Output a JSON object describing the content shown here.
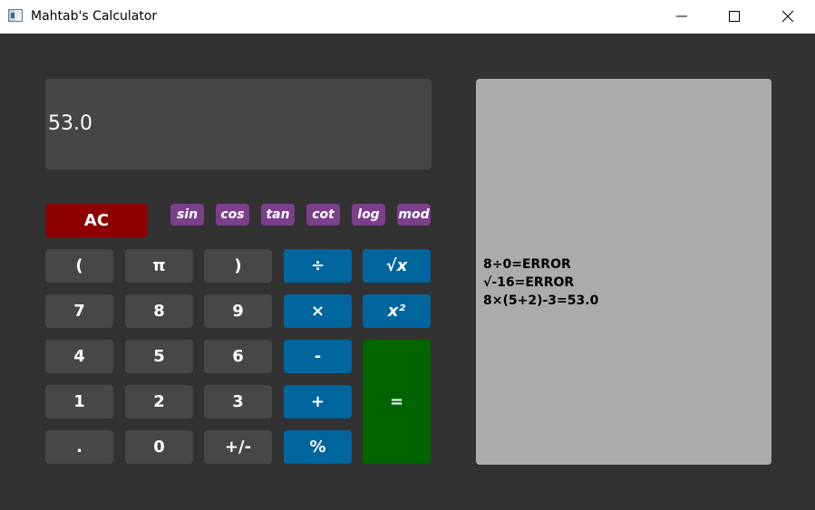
{
  "window": {
    "title": "Mahtab's Calculator",
    "controls": [
      "minimize",
      "maximize",
      "close"
    ]
  },
  "display": {
    "value": "53.0"
  },
  "history": {
    "entries": [
      "8÷0=ERROR",
      "√-16=ERROR",
      "8×(5+2)-3=53.0"
    ]
  },
  "buttons": {
    "ac": "AC",
    "functions": {
      "sin": "sin",
      "cos": "cos",
      "tan": "tan",
      "cot": "cot",
      "log": "log",
      "mod": "mod"
    },
    "lparen": "(",
    "pi": "π",
    "rparen": ")",
    "divide": "÷",
    "sqrt": "√x",
    "seven": "7",
    "eight": "8",
    "nine": "9",
    "multiply": "×",
    "square": "x²",
    "four": "4",
    "five": "5",
    "six": "6",
    "subtract": "-",
    "one": "1",
    "two": "2",
    "three": "3",
    "add": "+",
    "decimal": ".",
    "zero": "0",
    "negate": "+/-",
    "percent": "%",
    "equals": "="
  },
  "colors": {
    "background": "#323232",
    "number_key": "#474747",
    "operator_key": "#01659e",
    "function_key": "#7b3f8b",
    "clear_key": "#8c0000",
    "equals_key": "#006400",
    "display": "#464646",
    "history_panel": "#ababab"
  }
}
